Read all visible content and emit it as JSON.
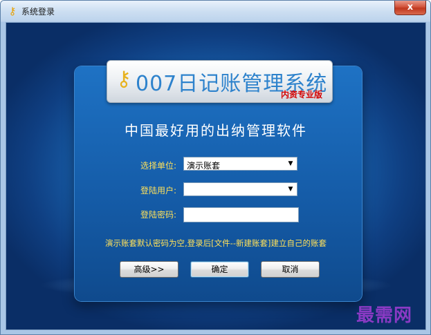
{
  "window": {
    "title": "系统登录",
    "close_label": "x"
  },
  "logo": {
    "title": "007日记账管理系统",
    "subtitle": "内资专业版"
  },
  "slogan": "中国最好用的出纳管理软件",
  "form": {
    "unit_label": "选择单位:",
    "unit_value": "演示账套",
    "user_label": "登陆用户:",
    "user_value": "",
    "password_label": "登陆密码:",
    "password_value": ""
  },
  "hint": "演示账套默认密码为空,登录后[文件--新建账套]建立自己的账套",
  "buttons": {
    "advanced": "高级>>",
    "ok": "确定",
    "cancel": "取消"
  },
  "watermark": "最需网",
  "icons": {
    "title_icon": "app-key-icon",
    "logo_icon": "app-key-icon",
    "dropdown_icon": "triangle-down-icon"
  },
  "colors": {
    "label_yellow": "#ffe15a",
    "logo_blue": "#2d82cc",
    "subtitle_red": "#d40000",
    "close_red": "#c0371e",
    "watermark_purple": "#8a3ac4"
  }
}
